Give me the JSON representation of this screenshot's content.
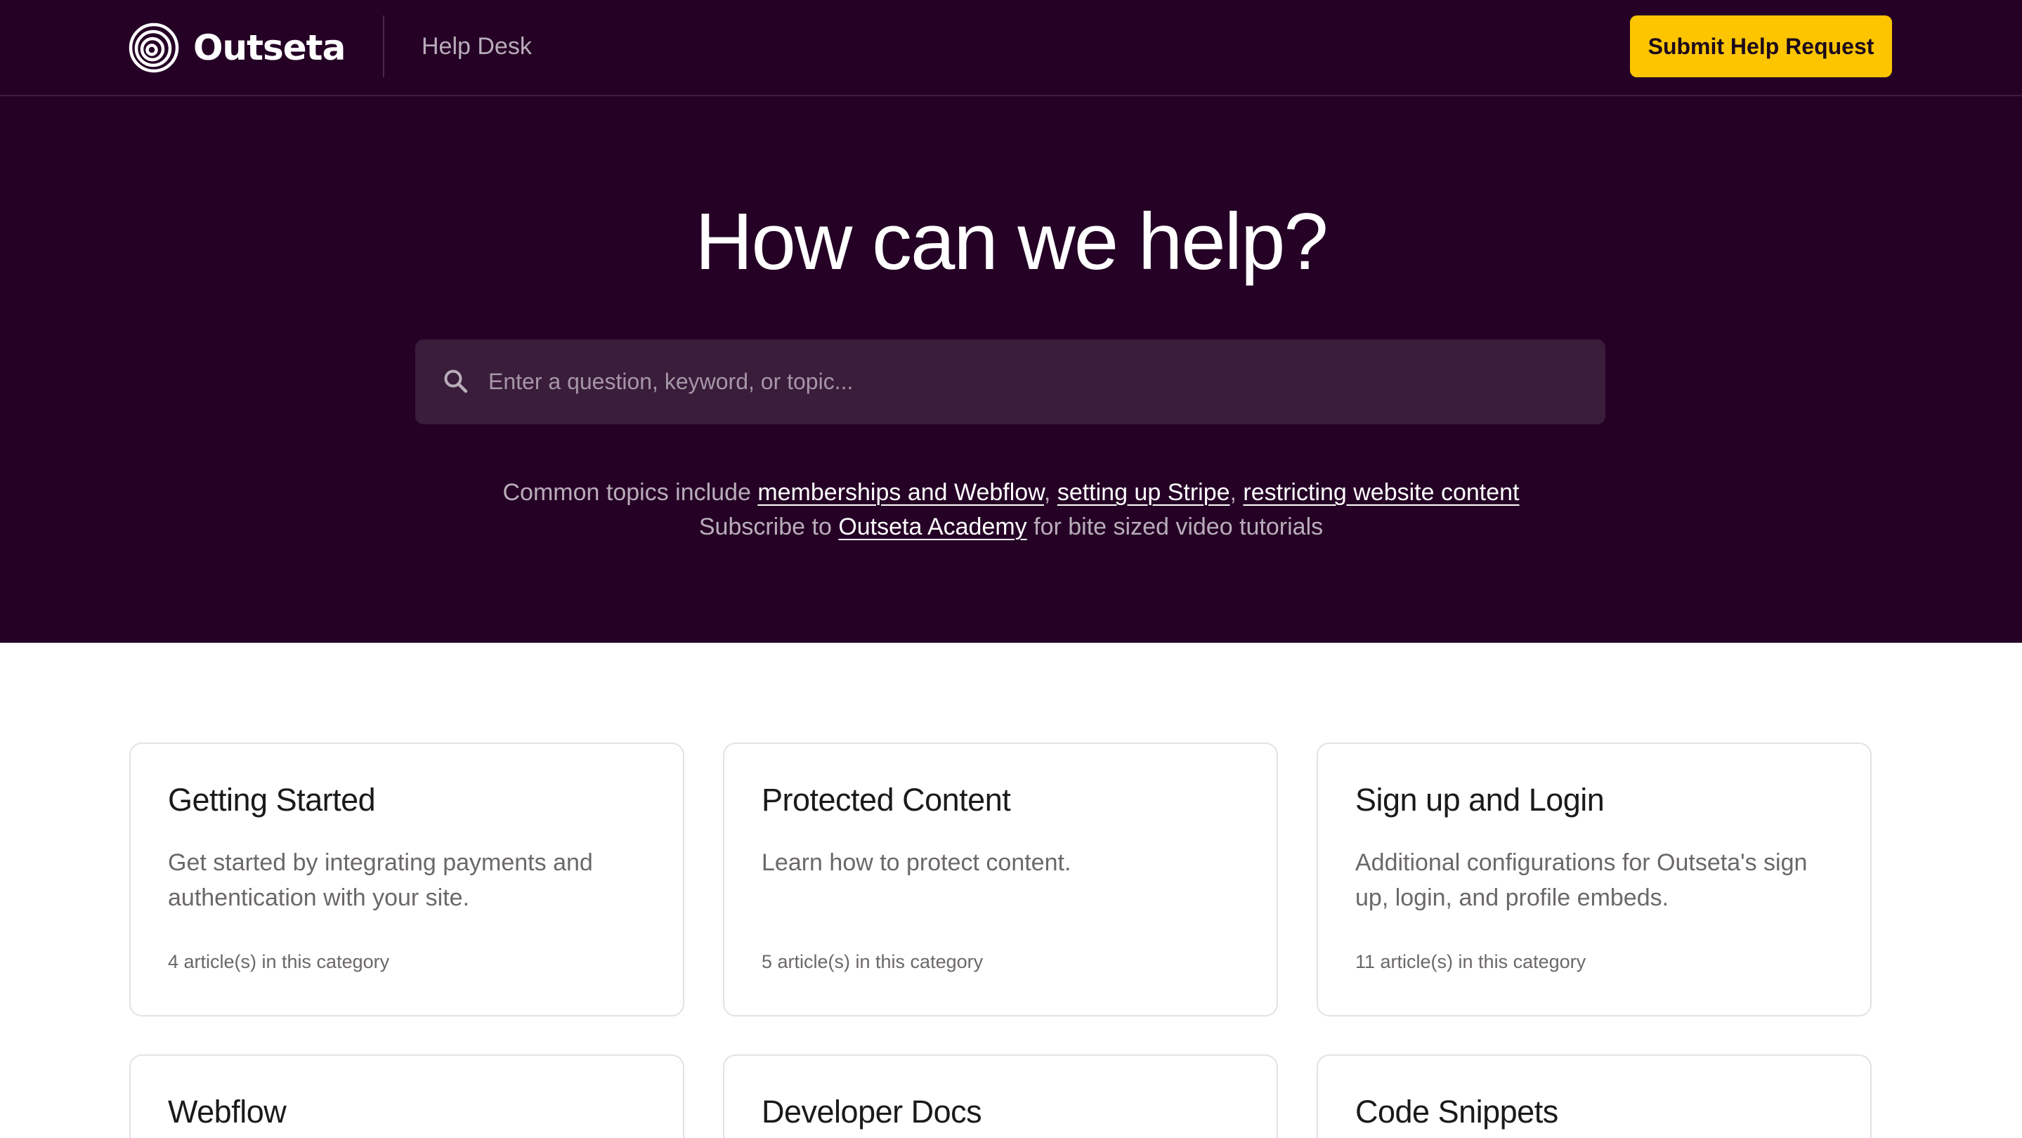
{
  "header": {
    "logo_text": "Outseta",
    "nav_label": "Help Desk",
    "submit_label": "Submit Help Request"
  },
  "hero": {
    "title": "How can we help?",
    "search_placeholder": "Enter a question, keyword, or topic...",
    "topics": {
      "prefix": "Common topics include ",
      "links": [
        "memberships and Webflow",
        "setting up Stripe",
        "restricting website content"
      ],
      "separator": ", "
    },
    "subscribe": {
      "prefix": "Subscribe to ",
      "link": "Outseta Academy",
      "suffix": " for bite sized video tutorials"
    }
  },
  "categories": [
    {
      "title": "Getting Started",
      "description": "Get started by integrating payments and authentication with your site.",
      "count": "4 article(s) in this category"
    },
    {
      "title": "Protected Content",
      "description": "Learn how to protect content.",
      "count": "5 article(s) in this category"
    },
    {
      "title": "Sign up and Login",
      "description": "Additional configurations for Outseta's sign up, login, and profile embeds.",
      "count": "11 article(s) in this category"
    },
    {
      "title": "Webflow",
      "description": "",
      "count": ""
    },
    {
      "title": "Developer Docs",
      "description": "",
      "count": ""
    },
    {
      "title": "Code Snippets",
      "description": "",
      "count": ""
    }
  ],
  "colors": {
    "hero_background": "#250126",
    "accent_button": "#fdc500",
    "search_background": "#3a1c3b"
  },
  "icons": {
    "logo": "concentric-circles-logo-icon",
    "search": "search-icon"
  }
}
